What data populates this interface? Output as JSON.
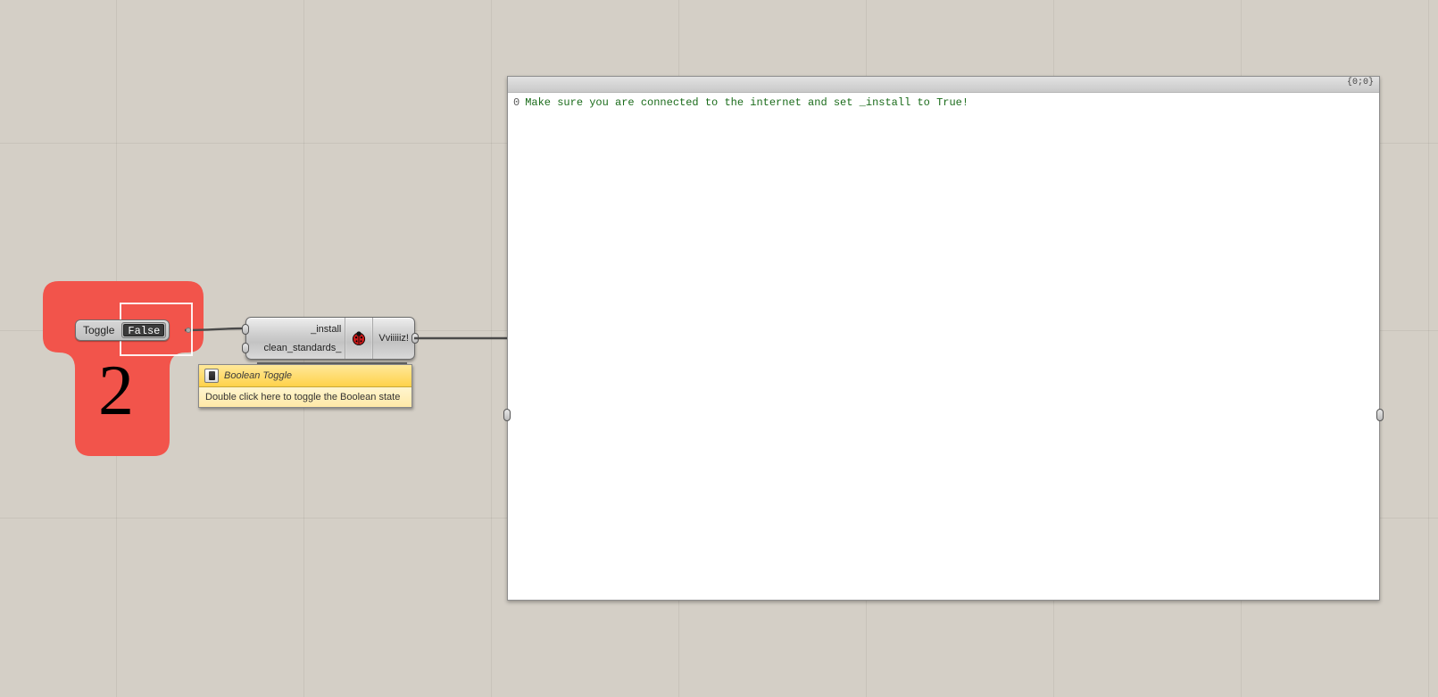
{
  "group": {
    "number": "2"
  },
  "toggle": {
    "label": "Toggle",
    "value": "False"
  },
  "component": {
    "input1": "_install",
    "input2": "clean_standards_",
    "output": "Vviiiiiz!"
  },
  "tooltip": {
    "title": "Boolean Toggle",
    "body": "Double click here to toggle the Boolean state"
  },
  "panel": {
    "path": "{0;0}",
    "line_index": "0",
    "line_text": "Make sure you are connected to the internet and set _install to True!"
  }
}
